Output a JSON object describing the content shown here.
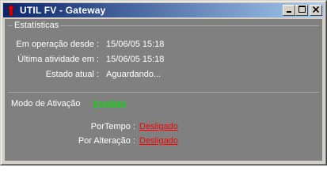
{
  "window": {
    "title": "UTIL FV - Gateway",
    "icon": "red-arrow-icon",
    "buttons": [
      "minimize-icon",
      "maximize-icon",
      "close-icon"
    ]
  },
  "stats": {
    "group_title": "Estatísticas",
    "rows": [
      {
        "label": "Em operação desde :",
        "value": "15/06/05 15:18"
      },
      {
        "label": "Última  atividade em :",
        "value": "15/06/05 15:18"
      },
      {
        "label": "Estado atual :",
        "value": "Aguardando..."
      }
    ]
  },
  "activation": {
    "label": "Modo de Ativação",
    "value": "Imediato",
    "value_color": "#00e000"
  },
  "triggers": {
    "rows": [
      {
        "label": "PorTempo :",
        "value": "Desligado"
      },
      {
        "label": "Por Alteração :",
        "value": "Desligado"
      }
    ],
    "value_color": "#ff0000"
  },
  "colors": {
    "title_bar_start": "#0a246a",
    "title_bar_end": "#a6caf0",
    "panel_bg": "#808080",
    "chrome_bg": "#d4d0c8"
  }
}
